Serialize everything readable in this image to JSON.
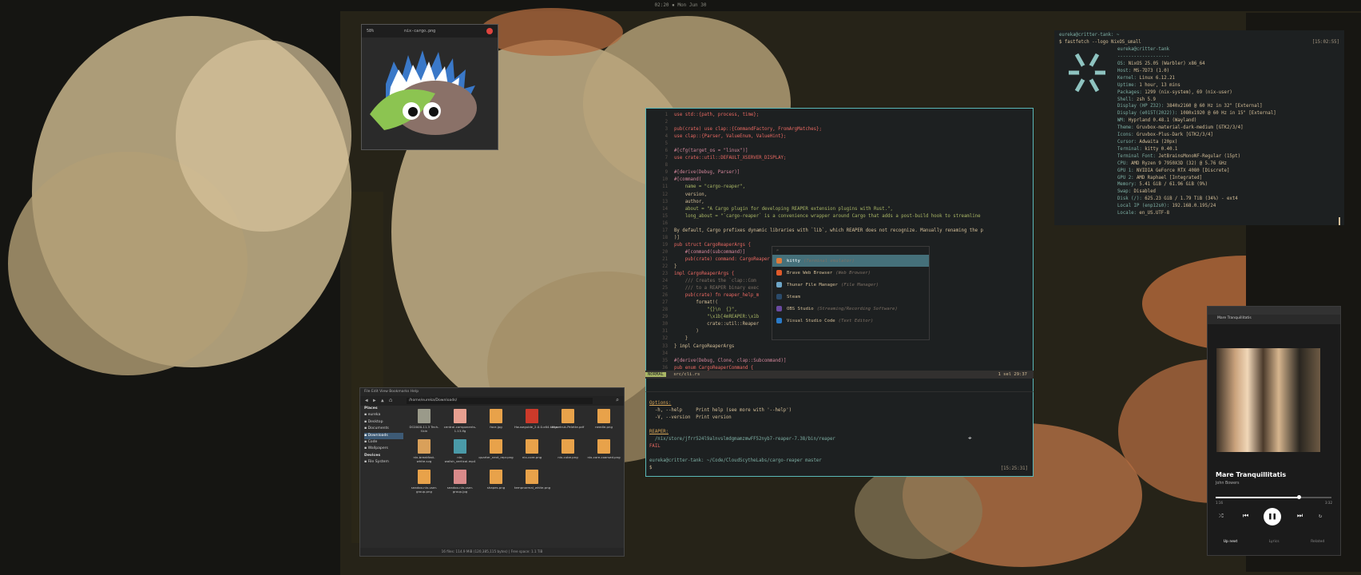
{
  "colors": {
    "accent": "#5ab8b8",
    "select": "#45707a",
    "red": "#ea6962",
    "green": "#a9b665",
    "yellow": "#d8a657",
    "blue": "#7daea3",
    "purple": "#d3869b",
    "fg": "#d4be98"
  },
  "topbar": {
    "clock": "02:20  ▪  Mon Jun 30"
  },
  "image_viewer": {
    "zoom": "58%",
    "title": "nix-cargo.png"
  },
  "editor": {
    "lines": [
      {
        "n": "1",
        "t": "use std::{path, process, time};"
      },
      {
        "n": "2",
        "t": ""
      },
      {
        "n": "3",
        "t": "pub(crate) use clap::{CommandFactory, FromArgMatches};"
      },
      {
        "n": "4",
        "t": "use clap::{Parser, ValueEnum, ValueHint};"
      },
      {
        "n": "5",
        "t": ""
      },
      {
        "n": "6",
        "t": "#[cfg(target_os = \"linux\")]"
      },
      {
        "n": "7",
        "t": "use crate::util::DEFAULT_XSERVER_DISPLAY;"
      },
      {
        "n": "8",
        "t": ""
      },
      {
        "n": "9",
        "t": "#[derive(Debug, Parser)]"
      },
      {
        "n": "10",
        "t": "#[command("
      },
      {
        "n": "11",
        "t": "    name = \"cargo-reaper\","
      },
      {
        "n": "12",
        "t": "    version,"
      },
      {
        "n": "13",
        "t": "    author,"
      },
      {
        "n": "14",
        "t": "    about = \"A Cargo plugin for developing REAPER extension plugins with Rust.\","
      },
      {
        "n": "15",
        "t": "    long_about = \"`cargo-reaper` is a convenience wrapper around Cargo that adds a post-build hook to streamline"
      },
      {
        "n": "16",
        "t": ""
      },
      {
        "n": "17",
        "t": "By default, Cargo prefixes dynamic libraries with `lib`, which REAPER does not recognize. Manually renaming the p"
      },
      {
        "n": "18",
        "t": ")]"
      },
      {
        "n": "19",
        "t": "pub struct CargoReaperArgs {"
      },
      {
        "n": "20",
        "t": "    #[command(subcommand)]"
      },
      {
        "n": "21",
        "t": "    pub(crate) command: CargoReaper"
      },
      {
        "n": "22",
        "t": "}"
      },
      {
        "n": "23",
        "t": "impl CargoReaperArgs {"
      },
      {
        "n": "24",
        "t": "    /// Creates the `clap::Com                                            path"
      },
      {
        "n": "25",
        "t": "    /// to a REAPER binary exec"
      },
      {
        "n": "26",
        "t": "    pub(crate) fn reaper_help_m                                          ring {"
      },
      {
        "n": "27",
        "t": "        format!("
      },
      {
        "n": "28",
        "t": "            \"{}\\n  {}\","
      },
      {
        "n": "29",
        "t": "            \"\\x1b[4mREAPER:\\x1b"
      },
      {
        "n": "30",
        "t": "            crate::util::Reaper"
      },
      {
        "n": "31",
        "t": "        )"
      },
      {
        "n": "32",
        "t": "    }"
      },
      {
        "n": "33",
        "t": "} impl CargoReaperArgs"
      },
      {
        "n": "34",
        "t": ""
      },
      {
        "n": "35",
        "t": "#[derive(Debug, Clone, clap::Subcommand)]"
      },
      {
        "n": "36",
        "t": "pub enum CargoReaperCommand {"
      }
    ],
    "status_mode": "NORMAL",
    "status_file": "src/cli.rs",
    "status_right": "1 sel  29:37"
  },
  "terminal": {
    "lines": [
      "Options:",
      "  -h, --help     Print help (see more with '--help')",
      "  -V, --version  Print version",
      "",
      "REAPER:",
      "  /nix/store/jfrr524l9alnvslmdgmamzmwFF52nyb7-reaper-7.38/bin/reaper",
      "FAIL",
      "",
      "eureka@critter-tank: ~/Code/CloudScytheLabs/cargo-reaper master",
      "$ "
    ],
    "time": "[15:25:31]"
  },
  "launcher": {
    "items": [
      {
        "name": "kitty",
        "desc": "(Terminal emulator)"
      },
      {
        "name": "Brave Web Browser",
        "desc": "(Web Browser)"
      },
      {
        "name": "Thunar File Manager",
        "desc": "(File Manager)"
      },
      {
        "name": "Steam",
        "desc": ""
      },
      {
        "name": "OBS Studio",
        "desc": "(Streaming/Recording Software)"
      },
      {
        "name": "Visual Studio Code",
        "desc": "(Text Editor)"
      }
    ]
  },
  "fastfetch": {
    "prompt": "eureka@critter-tank: ~",
    "command": "$ fastfetch --logo NixOS_small",
    "time": "[15:02:55]",
    "user": "eureka@critter-tank",
    "sep": "-------------------",
    "info": [
      "OS: NixOS 25.05 (Warbler) x86_64",
      "Host: MS-7D73 (1.0)",
      "Kernel: Linux 6.12.21",
      "Uptime: 1 hour, 13 mins",
      "Packages: 1299 (nix-system), 69 (nix-user)",
      "Shell: zsh 5.9",
      "Display (HP Z32): 3840x2160 @ 60 Hz in 32\" [External]",
      "Display (e015T(2022)): 1080x1920 @ 60 Hz in 15\" [External]",
      "WM: Hyprland 0.48.1 (Wayland)",
      "Theme: Gruvbox-material-dark-medium [GTK2/3/4]",
      "Icons: Gruvbox-Plus-Dark [GTK2/3/4]",
      "Cursor: Adwaita (20px)",
      "Terminal: kitty 0.40.1",
      "Terminal Font: JetBrainsMonoNF-Regular (15pt)",
      "CPU: AMD Ryzen 9 7950X3D (32) @ 5.76 GHz",
      "GPU 1: NVIDIA GeForce RTX 4080 [Discrete]",
      "GPU 2: AMD Raphael [Integrated]",
      "Memory: 5.41 GiB / 61.96 GiB (9%)",
      "Swap: Disabled",
      "Disk (/): 625.23 GiB / 1.79 TiB (34%) - ext4",
      "Local IP (enp12s0): 192.168.0.195/24",
      "Locale: en_US.UTF-8"
    ]
  },
  "files": {
    "menu": "File  Edit  View  Bookmarks  Help",
    "path": "/home/eureka/Downloads/",
    "places_header": "Places",
    "places": [
      "eureka",
      "Desktop",
      "Documents",
      "Downloads",
      "Code",
      "Wallpapers"
    ],
    "devices_header": "Devices",
    "devices": [
      "File System"
    ],
    "files": [
      {
        "name": "DC0000-11.3 Tech-f.bin",
        "color": "#9a9a8a"
      },
      {
        "name": "central-components-1.13.lfg",
        "color": "#e8a090"
      },
      {
        "name": "face.jpg",
        "color": "#e8a24a"
      },
      {
        "name": "Houseguide_2.0.0.x64.targz",
        "color": "#cc3a2a"
      },
      {
        "name": "Musetruk-Pelette.pdf",
        "color": "#e8a24a"
      },
      {
        "name": "needle.png",
        "color": "#e8a24a"
      },
      {
        "name": "nix-breakfast-white.svg",
        "color": "#d9a05a"
      },
      {
        "name": "nix-wallsh_vertical.mp4",
        "color": "#4a9aa8"
      },
      {
        "name": "quarter_next_repr.png",
        "color": "#e8a24a"
      },
      {
        "name": "nix-core.png",
        "color": "#e8a24a"
      },
      {
        "name": "nix-cube.png",
        "color": "#e8a24a"
      },
      {
        "name": "nix-core-coarsed.png",
        "color": "#e8a24a"
      },
      {
        "name": "seadoo-nix-user-group.png",
        "color": "#e8a24a"
      },
      {
        "name": "seadoo-nix-user-group.jpg",
        "color": "#d98a8a"
      },
      {
        "name": "shapes.png",
        "color": "#e8a24a"
      },
      {
        "name": "tempnormal_white.png",
        "color": "#e8a24a"
      }
    ],
    "footer": "16 files: 114.9 MiB (120,385,115 bytes) | Free space: 1.1 TiB"
  },
  "player": {
    "tab": "Mare Tranquillitatis",
    "track": "Mare Tranquillitatis",
    "artist": "John Bowers",
    "time_left": "1:16",
    "time_right": "3:32",
    "progress": 0.72,
    "tabs": [
      "Up next",
      "Lyrics",
      "Related"
    ]
  }
}
